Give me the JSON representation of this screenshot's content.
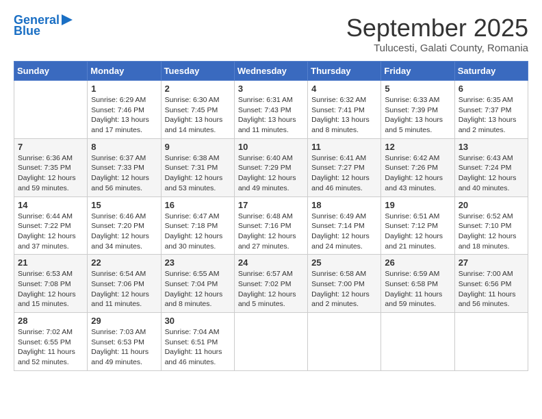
{
  "logo": {
    "line1": "General",
    "line2": "Blue"
  },
  "title": "September 2025",
  "location": "Tulucesti, Galati County, Romania",
  "weekdays": [
    "Sunday",
    "Monday",
    "Tuesday",
    "Wednesday",
    "Thursday",
    "Friday",
    "Saturday"
  ],
  "weeks": [
    [
      {
        "day": "",
        "info": ""
      },
      {
        "day": "1",
        "info": "Sunrise: 6:29 AM\nSunset: 7:46 PM\nDaylight: 13 hours\nand 17 minutes."
      },
      {
        "day": "2",
        "info": "Sunrise: 6:30 AM\nSunset: 7:45 PM\nDaylight: 13 hours\nand 14 minutes."
      },
      {
        "day": "3",
        "info": "Sunrise: 6:31 AM\nSunset: 7:43 PM\nDaylight: 13 hours\nand 11 minutes."
      },
      {
        "day": "4",
        "info": "Sunrise: 6:32 AM\nSunset: 7:41 PM\nDaylight: 13 hours\nand 8 minutes."
      },
      {
        "day": "5",
        "info": "Sunrise: 6:33 AM\nSunset: 7:39 PM\nDaylight: 13 hours\nand 5 minutes."
      },
      {
        "day": "6",
        "info": "Sunrise: 6:35 AM\nSunset: 7:37 PM\nDaylight: 13 hours\nand 2 minutes."
      }
    ],
    [
      {
        "day": "7",
        "info": "Sunrise: 6:36 AM\nSunset: 7:35 PM\nDaylight: 12 hours\nand 59 minutes."
      },
      {
        "day": "8",
        "info": "Sunrise: 6:37 AM\nSunset: 7:33 PM\nDaylight: 12 hours\nand 56 minutes."
      },
      {
        "day": "9",
        "info": "Sunrise: 6:38 AM\nSunset: 7:31 PM\nDaylight: 12 hours\nand 53 minutes."
      },
      {
        "day": "10",
        "info": "Sunrise: 6:40 AM\nSunset: 7:29 PM\nDaylight: 12 hours\nand 49 minutes."
      },
      {
        "day": "11",
        "info": "Sunrise: 6:41 AM\nSunset: 7:27 PM\nDaylight: 12 hours\nand 46 minutes."
      },
      {
        "day": "12",
        "info": "Sunrise: 6:42 AM\nSunset: 7:26 PM\nDaylight: 12 hours\nand 43 minutes."
      },
      {
        "day": "13",
        "info": "Sunrise: 6:43 AM\nSunset: 7:24 PM\nDaylight: 12 hours\nand 40 minutes."
      }
    ],
    [
      {
        "day": "14",
        "info": "Sunrise: 6:44 AM\nSunset: 7:22 PM\nDaylight: 12 hours\nand 37 minutes."
      },
      {
        "day": "15",
        "info": "Sunrise: 6:46 AM\nSunset: 7:20 PM\nDaylight: 12 hours\nand 34 minutes."
      },
      {
        "day": "16",
        "info": "Sunrise: 6:47 AM\nSunset: 7:18 PM\nDaylight: 12 hours\nand 30 minutes."
      },
      {
        "day": "17",
        "info": "Sunrise: 6:48 AM\nSunset: 7:16 PM\nDaylight: 12 hours\nand 27 minutes."
      },
      {
        "day": "18",
        "info": "Sunrise: 6:49 AM\nSunset: 7:14 PM\nDaylight: 12 hours\nand 24 minutes."
      },
      {
        "day": "19",
        "info": "Sunrise: 6:51 AM\nSunset: 7:12 PM\nDaylight: 12 hours\nand 21 minutes."
      },
      {
        "day": "20",
        "info": "Sunrise: 6:52 AM\nSunset: 7:10 PM\nDaylight: 12 hours\nand 18 minutes."
      }
    ],
    [
      {
        "day": "21",
        "info": "Sunrise: 6:53 AM\nSunset: 7:08 PM\nDaylight: 12 hours\nand 15 minutes."
      },
      {
        "day": "22",
        "info": "Sunrise: 6:54 AM\nSunset: 7:06 PM\nDaylight: 12 hours\nand 11 minutes."
      },
      {
        "day": "23",
        "info": "Sunrise: 6:55 AM\nSunset: 7:04 PM\nDaylight: 12 hours\nand 8 minutes."
      },
      {
        "day": "24",
        "info": "Sunrise: 6:57 AM\nSunset: 7:02 PM\nDaylight: 12 hours\nand 5 minutes."
      },
      {
        "day": "25",
        "info": "Sunrise: 6:58 AM\nSunset: 7:00 PM\nDaylight: 12 hours\nand 2 minutes."
      },
      {
        "day": "26",
        "info": "Sunrise: 6:59 AM\nSunset: 6:58 PM\nDaylight: 11 hours\nand 59 minutes."
      },
      {
        "day": "27",
        "info": "Sunrise: 7:00 AM\nSunset: 6:56 PM\nDaylight: 11 hours\nand 56 minutes."
      }
    ],
    [
      {
        "day": "28",
        "info": "Sunrise: 7:02 AM\nSunset: 6:55 PM\nDaylight: 11 hours\nand 52 minutes."
      },
      {
        "day": "29",
        "info": "Sunrise: 7:03 AM\nSunset: 6:53 PM\nDaylight: 11 hours\nand 49 minutes."
      },
      {
        "day": "30",
        "info": "Sunrise: 7:04 AM\nSunset: 6:51 PM\nDaylight: 11 hours\nand 46 minutes."
      },
      {
        "day": "",
        "info": ""
      },
      {
        "day": "",
        "info": ""
      },
      {
        "day": "",
        "info": ""
      },
      {
        "day": "",
        "info": ""
      }
    ]
  ]
}
